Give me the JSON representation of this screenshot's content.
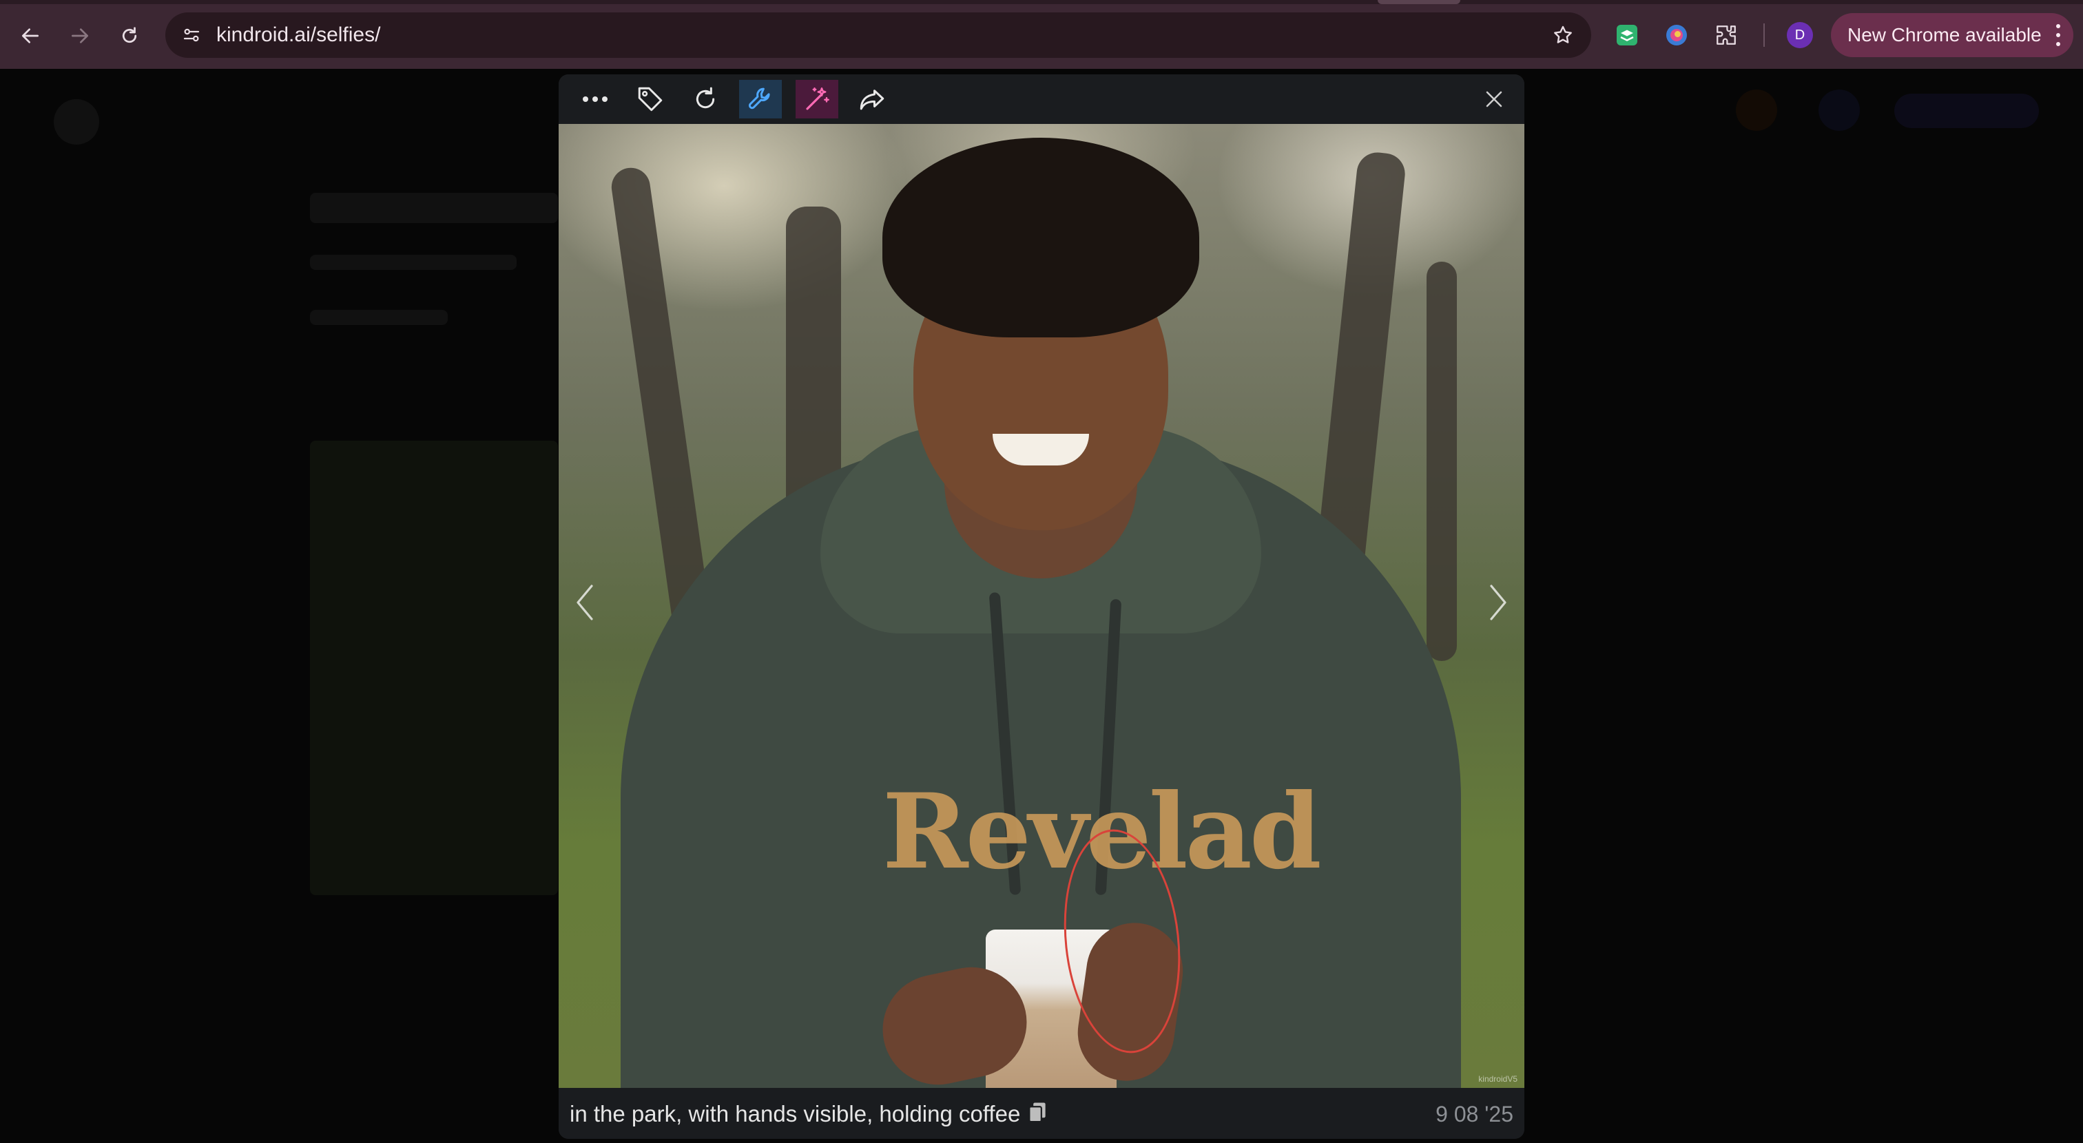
{
  "browser": {
    "url": "kindroid.ai/selfies/",
    "profile_initial": "D",
    "update_label": "New Chrome available"
  },
  "modal": {
    "toolbar_icons": [
      "more-icon",
      "tag-icon",
      "refresh-icon",
      "wrench-icon",
      "magic-wand-icon",
      "share-icon",
      "close-icon"
    ],
    "caption": "in the park, with hands visible, holding coffee",
    "date": "9 08 '25",
    "watermark": "kindroidV5",
    "print_text": "Revelad"
  },
  "colors": {
    "chrome": "#3c2733",
    "omnibox": "#28181f",
    "update_pill": "#6b2f4d",
    "modal": "#1a1c1f",
    "wrench_bg": "#1f3850",
    "wand_bg": "#4b1a3b",
    "annotation": "#d9433a"
  }
}
